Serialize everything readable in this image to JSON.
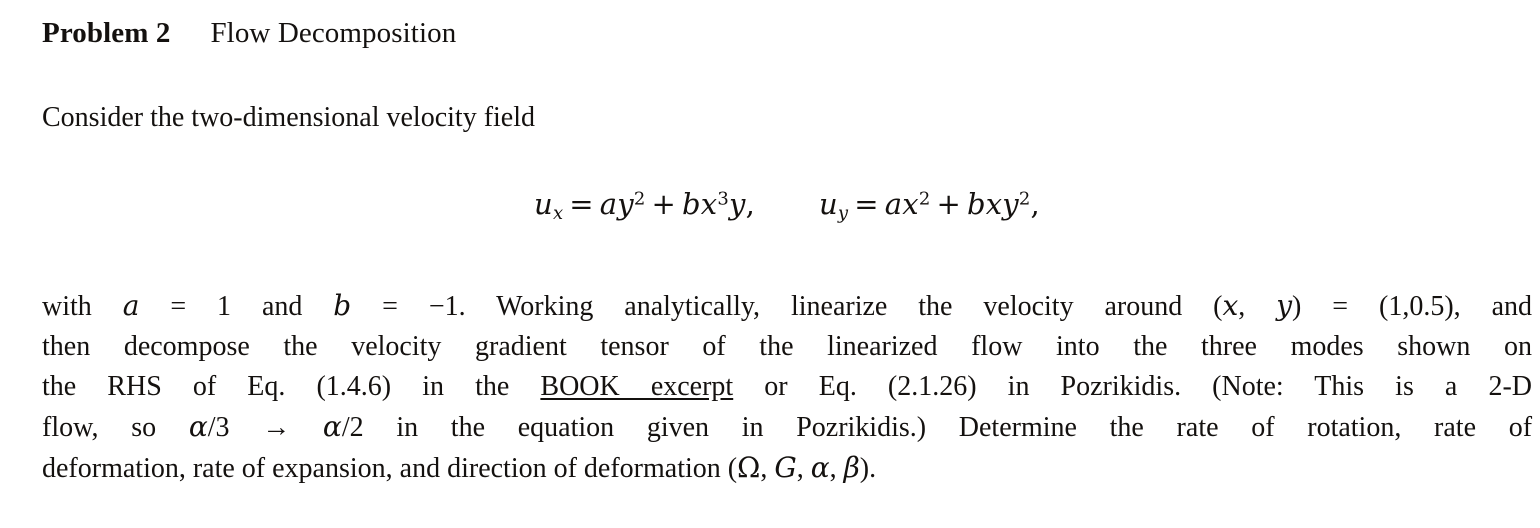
{
  "document": {
    "heading": {
      "problem_label": "Problem 2",
      "problem_title": "Flow Decomposition"
    },
    "intro": "Consider the two-dimensional velocity field",
    "equation": {
      "plain_text": "u_x = a y^2 + b x^3 y,    u_y = a x^2 + b x y^2,",
      "lhs1": "u",
      "lhs1_sub": "x",
      "eq": "=",
      "term1_coeff": "a",
      "term1_var": "y",
      "term1_exp": "2",
      "plus": "+",
      "term2_coeff": "b",
      "term2_var": "x",
      "term2_exp": "3",
      "term2_var2": "y",
      "comma1": ",",
      "lhs2": "u",
      "lhs2_sub": "y",
      "term3_coeff": "a",
      "term3_var": "x",
      "term3_exp": "2",
      "term4_coeff": "b",
      "term4_var1": "x",
      "term4_var2": "y",
      "term4_exp": "2",
      "comma2": ","
    },
    "paragraph": {
      "full_text": "with a = 1 and b = −1. Working analytically, linearize the velocity around (x, y) = (1,0.5), and then decompose the velocity gradient tensor of the linearized flow into the three modes shown on the RHS of Eq. (1.4.6) in the BOOK excerpt or Eq. (2.1.26) in Pozrikidis. (Note: This is a 2-D flow, so α/3 → α/2 in the equation given in Pozrikidis.) Determine the rate of rotation, rate of deformation, rate of expansion, and direction of deformation (Ω, G, α, β).",
      "line1": {
        "seg1": "with ",
        "var_a": "a",
        "seg2": " = 1 and ",
        "var_b": "b",
        "seg3": " = −1.  Working analytically, linearize the velocity around (",
        "var_x": "x",
        "seg4": ", ",
        "var_y": "y",
        "seg5": ") = (1,0.5), and"
      },
      "line2": "then decompose the velocity gradient tensor of the linearized flow into the three modes shown on",
      "line3": {
        "seg1": "the RHS of Eq. (1.4.6) in the ",
        "link": "BOOK excerpt",
        "seg2": " or Eq. (2.1.26) in Pozrikidis.  (Note: This is a 2-D"
      },
      "line4": {
        "seg1": "flow, so ",
        "alpha1": "α",
        "seg2": "/3 → ",
        "alpha2": "α",
        "seg3": "/2 in the equation given in Pozrikidis.)  Determine the rate of rotation, rate of"
      },
      "line5": {
        "seg1": "deformation, rate of expansion, and direction of deformation (",
        "omega": "Ω",
        "sep1": ", ",
        "gvar": "G",
        "sep2": ", ",
        "alpha": "α",
        "sep3": ", ",
        "beta": "β",
        "seg2": ")."
      }
    }
  },
  "colors": {
    "background": "#ffffff",
    "text": "#14110f"
  }
}
